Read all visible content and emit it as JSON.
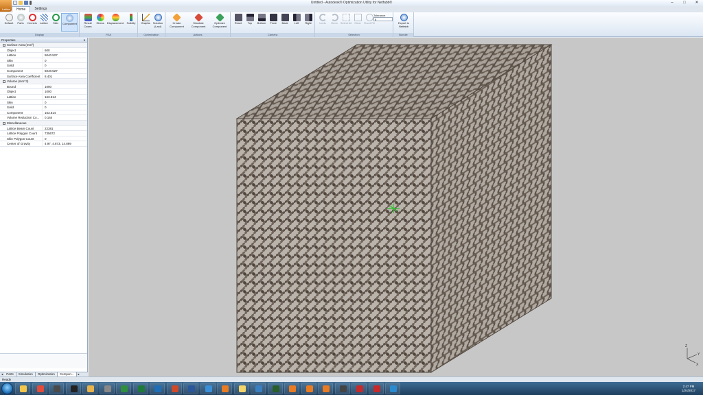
{
  "app": {
    "window_title": "Untitled - Autodesk® Optimization Utility for Netfabb®",
    "menu_button": "Lattice",
    "tabs": [
      {
        "label": "Home"
      },
      {
        "label": "Settings"
      }
    ]
  },
  "ribbon": {
    "groups": [
      {
        "label": "Display",
        "items": [
          "Default",
          "Parts",
          "Kernels",
          "Lattice",
          "Skin",
          "Component"
        ]
      },
      {
        "label": "FEA",
        "items": [
          "Result Cases",
          "Stress",
          "Displacement",
          "Solidity"
        ]
      },
      {
        "label": "Optimization",
        "items": [
          "Graphs",
          "Solution (Last)"
        ]
      },
      {
        "label": "Actions",
        "items": [
          "Create Component",
          "Simulate Component",
          "Optimize Component"
        ]
      },
      {
        "label": "Camera",
        "items": [
          "Reset",
          "Top",
          "Bottom",
          "Front",
          "Back",
          "Left",
          "Right"
        ]
      },
      {
        "label": "Selection",
        "items": [
          "Undo",
          "Redo",
          "Select All",
          "Clear",
          "Flood Fill"
        ]
      },
      {
        "label": "Bundle",
        "items": [
          "Export to Netfabb"
        ]
      }
    ],
    "tolerance": {
      "label": "Tolerance",
      "value": "5"
    }
  },
  "properties": {
    "title": "Properties",
    "pin": "▾",
    "sections": [
      {
        "name": "Surface Area (mm²)",
        "rows": [
          {
            "k": "Object",
            "v": "600"
          },
          {
            "k": "Lattice",
            "v": "5040.527"
          },
          {
            "k": "Skin",
            "v": "0"
          },
          {
            "k": "Solid",
            "v": "0"
          },
          {
            "k": "Component",
            "v": "5040.527"
          },
          {
            "k": "Surface Area Coefficient",
            "v": "8.401"
          }
        ]
      },
      {
        "name": "Volume (mm^3)",
        "rows": [
          {
            "k": "Bound",
            "v": "1000"
          },
          {
            "k": "Object",
            "v": "1000"
          },
          {
            "k": "Lattice",
            "v": "163.514"
          },
          {
            "k": "Skin",
            "v": "0"
          },
          {
            "k": "Solid",
            "v": "0"
          },
          {
            "k": "Component",
            "v": "163.514"
          },
          {
            "k": "Volume Reduction Co...",
            "v": "0.164"
          }
        ]
      },
      {
        "name": "Miscellaneous",
        "rows": [
          {
            "k": "Lattice Beam Count",
            "v": "22381"
          },
          {
            "k": "Lattice Polygon Count",
            "v": "735672"
          },
          {
            "k": "Skin Polygon Count",
            "v": "0"
          },
          {
            "k": "Center of Gravity",
            "v": "4.97, 4.873, 14.899"
          }
        ]
      }
    ]
  },
  "panel_tabs": [
    {
      "label": "◂"
    },
    {
      "label": "Parts"
    },
    {
      "label": "Simulation"
    },
    {
      "label": "Optimization"
    },
    {
      "label": "Compon..."
    },
    {
      "label": "▸"
    }
  ],
  "viewport": {
    "axis_z": "Z",
    "axis_y": "Y",
    "axis_x": "X",
    "colors": {
      "background": "#c7c7c7",
      "lattice": "#6e6257",
      "lattice_dark": "#4f463e",
      "pivot": "#2fbf2f"
    }
  },
  "status": {
    "text": "Ready"
  },
  "taskbar": {
    "time": "2:47 PM",
    "date": "1/24/2017",
    "apps": [
      "explorer-icon",
      "chrome-icon",
      "media-icon",
      "terminal-icon",
      "paint-icon",
      "tool-icon",
      "bars-icon",
      "excel-icon",
      "outlook-icon",
      "powerpoint-icon",
      "word-icon",
      "camera-icon",
      "netfabb-icon",
      "folder-icon",
      "photo-icon",
      "monitor-icon",
      "netfabb-icon",
      "netfabb-icon",
      "netfabb-icon",
      "capture-icon",
      "pdf-icon",
      "pdf-icon",
      "remote-icon"
    ]
  }
}
